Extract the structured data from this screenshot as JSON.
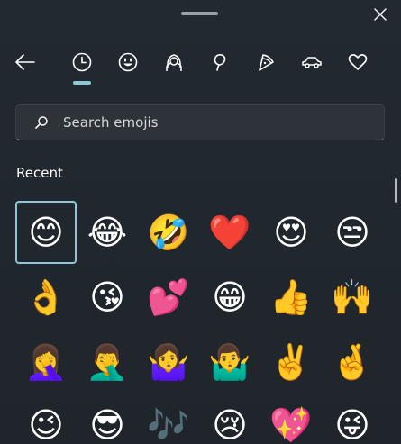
{
  "window": {
    "close_label": "Close",
    "accent": "#8ec7d8",
    "background": "#20262c"
  },
  "tabs": [
    {
      "name": "back",
      "icon": "back-arrow-icon"
    },
    {
      "name": "recent",
      "icon": "clock-icon",
      "selected": true
    },
    {
      "name": "smileys",
      "icon": "smiley-icon"
    },
    {
      "name": "people",
      "icon": "person-icon"
    },
    {
      "name": "nature",
      "icon": "leaf-icon"
    },
    {
      "name": "food",
      "icon": "pizza-icon"
    },
    {
      "name": "travel",
      "icon": "car-icon"
    },
    {
      "name": "symbols",
      "icon": "heart-icon"
    }
  ],
  "search": {
    "placeholder": "Search emojis",
    "value": ""
  },
  "section": {
    "title": "Recent"
  },
  "emojis": [
    [
      "😊",
      "😂",
      "🤣",
      "❤️",
      "😍",
      "😒"
    ],
    [
      "👌",
      "😘",
      "💕",
      "😁",
      "👍",
      "🙌"
    ],
    [
      "🤦‍♀️",
      "🤦‍♂️",
      "🤷‍♀️",
      "🤷‍♂️",
      "✌️",
      "🤞"
    ],
    [
      "😉",
      "😎",
      "🎶",
      "😢",
      "💖",
      "😜"
    ]
  ]
}
